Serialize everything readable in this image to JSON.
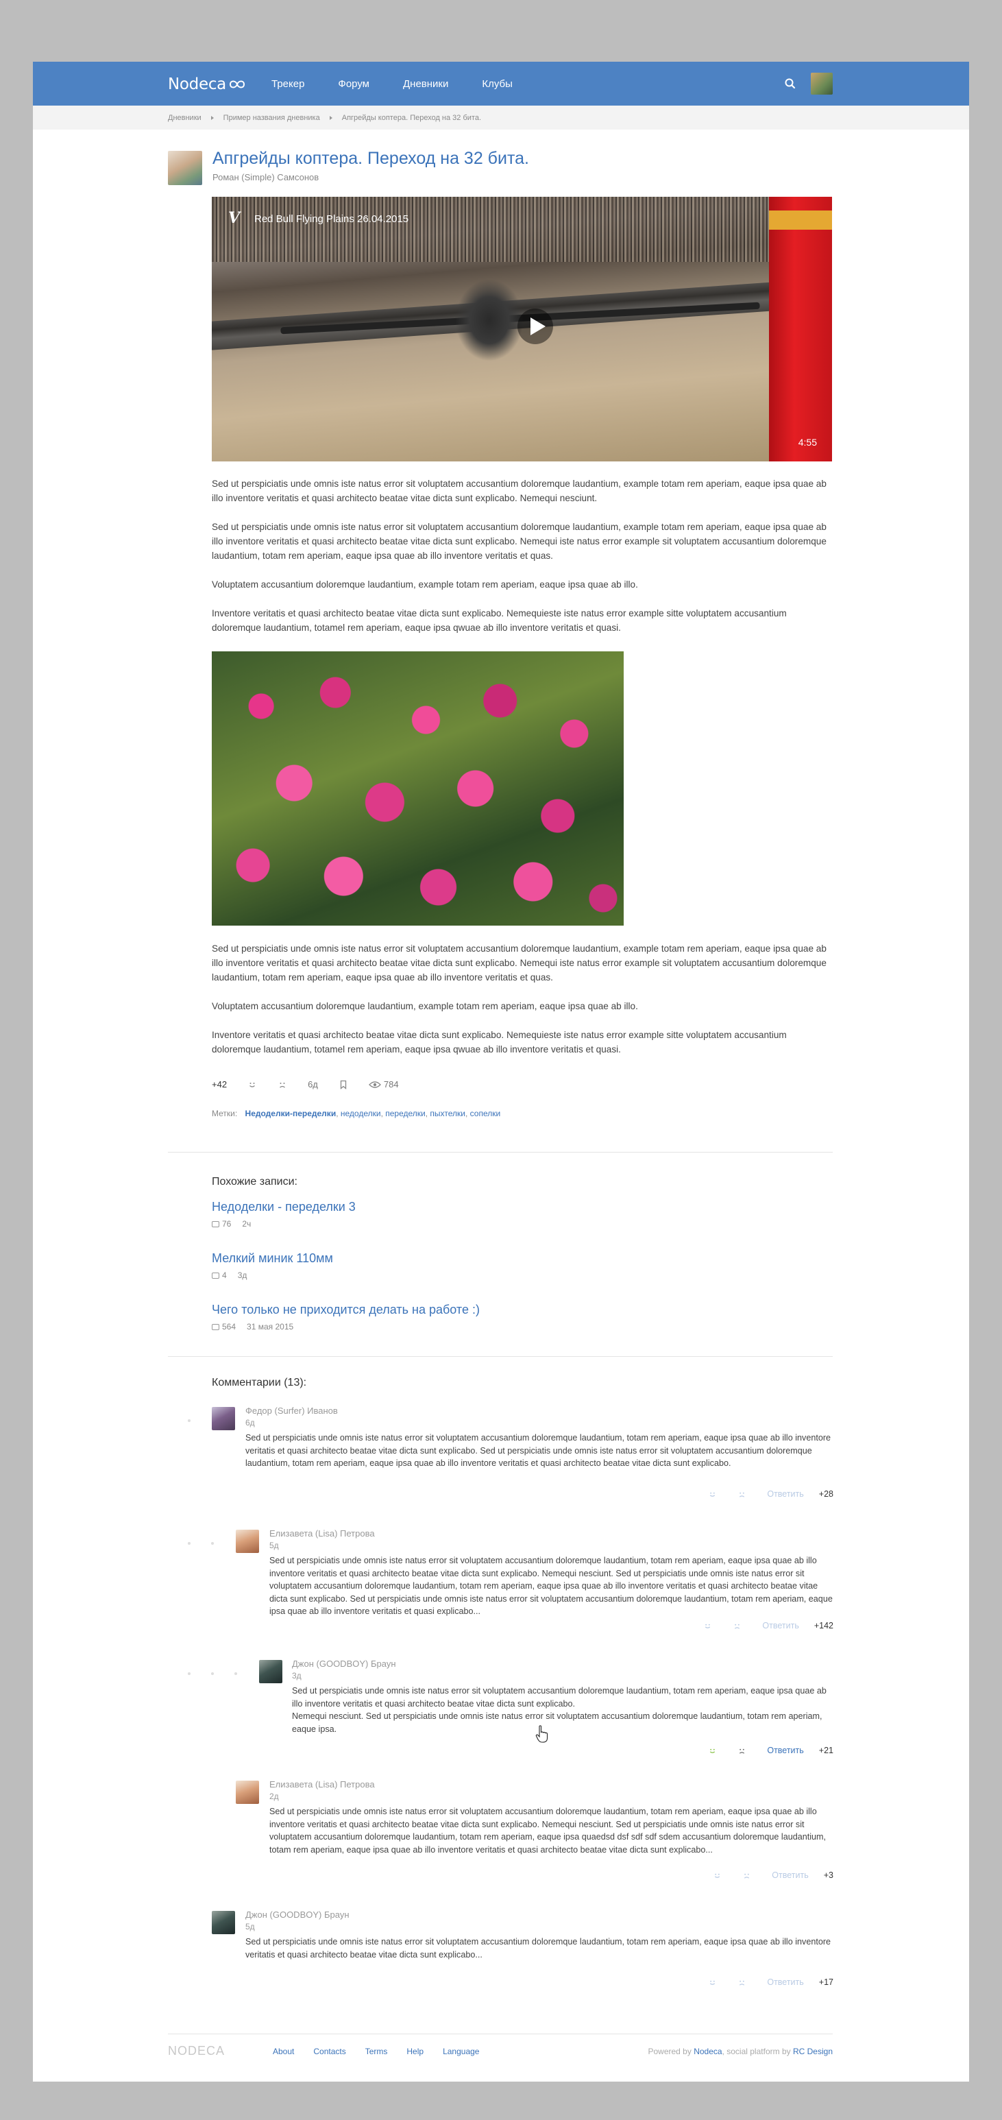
{
  "header": {
    "logo": "Nodeca",
    "nav": [
      "Трекер",
      "Форум",
      "Дневники",
      "Клубы"
    ]
  },
  "breadcrumbs": [
    "Дневники",
    "Пример названия дневника",
    "Апгрейды коптера. Переход на 32 бита."
  ],
  "post": {
    "title": "Апгрейды коптера. Переход на 32 бита.",
    "author": "Роман (Simple) Самсонов",
    "video": {
      "title": "Red Bull Flying Plains 26.04.2015",
      "duration": "4:55",
      "logo": "V"
    },
    "paragraphs_top": [
      "Sed ut perspiciatis unde omnis iste natus error sit voluptatem accusantium doloremque laudantium, example totam rem aperiam, eaque ipsa quae ab illo inventore veritatis et quasi architecto beatae vitae dicta sunt explicabo. Nemequi nesciunt.",
      "Sed ut perspiciatis unde omnis iste natus error sit voluptatem accusantium doloremque laudantium, example totam rem aperiam, eaque ipsa quae ab illo inventore veritatis et quasi architecto beatae vitae dicta sunt explicabo. Nemequi iste natus error example sit voluptatem accusantium doloremque laudantium,  totam rem aperiam, eaque ipsa quae ab illo inventore veritatis et quas.",
      "Voluptatem accusantium doloremque laudantium, example totam rem aperiam, eaque ipsa quae ab illo.",
      "Inventore veritatis et quasi architecto beatae vitae dicta sunt explicabo. Nemequieste iste natus error example sitte voluptatem accusantium doloremque laudantium,  totamel rem aperiam, eaque ipsa qwuae ab illo inventore veritatis et quasi."
    ],
    "paragraphs_bottom": [
      "Sed ut perspiciatis unde omnis iste natus error sit voluptatem accusantium doloremque laudantium, example totam rem aperiam, eaque ipsa quae ab illo inventore veritatis et quasi architecto beatae vitae dicta sunt explicabo. Nemequi iste natus error example sit voluptatem accusantium doloremque laudantium,  totam rem aperiam, eaque ipsa quae ab illo inventore veritatis et quas.",
      "Voluptatem accusantium doloremque laudantium, example totam rem aperiam, eaque ipsa quae ab illo.",
      "Inventore veritatis et quasi architecto beatae vitae dicta sunt explicabo. Nemequieste iste natus error example sitte voluptatem accusantium doloremque laudantium,  totamel rem aperiam, eaque ipsa qwuae ab illo inventore veritatis et quasi."
    ],
    "votes": "+42",
    "age": "6д",
    "views": "784",
    "tags_label": "Метки:",
    "tags": [
      "Недоделки-переделки",
      "недоделки",
      "переделки",
      "пыхтелки",
      "сопелки"
    ]
  },
  "similar": {
    "heading": "Похожие записи:",
    "items": [
      {
        "title": "Недоделки - переделки 3",
        "comments": "76",
        "age": "2ч"
      },
      {
        "title": "Мелкий миник 110мм",
        "comments": "4",
        "age": "3д"
      },
      {
        "title": "Чего только не приходится делать на работе :)",
        "comments": "564",
        "age": "31 мая 2015"
      }
    ]
  },
  "comments": {
    "heading": "Комментарии (13):",
    "reply_label": "Ответить",
    "items": [
      {
        "name": "Федор (Surfer) Иванов",
        "age": "6д",
        "text": "Sed ut perspiciatis unde omnis iste natus error sit voluptatem accusantium doloremque laudantium, totam rem aperiam, eaque ipsa quae ab illo inventore veritatis et quasi architecto beatae vitae dicta sunt explicabo. Sed ut perspiciatis unde omnis iste natus error sit voluptatem accusantium doloremque laudantium, totam rem aperiam, eaque ipsa quae ab illo inventore veritatis et quasi architecto beatae vitae dicta sunt explicabo.",
        "score": "+28"
      },
      {
        "name": "Елизавета (Lisa) Петрова",
        "age": "5д",
        "text": "Sed ut perspiciatis unde omnis iste natus error sit voluptatem accusantium doloremque laudantium, totam rem aperiam, eaque ipsa quae ab illo inventore veritatis et quasi architecto beatae vitae dicta sunt explicabo. Nemequi nesciunt. Sed ut perspiciatis unde omnis iste natus error sit voluptatem accusantium doloremque laudantium, totam rem aperiam, eaque ipsa quae ab illo inventore veritatis et quasi architecto beatae vitae dicta sunt explicabo. Sed ut perspiciatis unde omnis iste natus error sit voluptatem accusantium doloremque laudantium, totam rem aperiam, eaque ipsa quae ab illo inventore veritatis et quasi explicabo...",
        "score": "+142"
      },
      {
        "name": "Джон (GOODBOY) Браун",
        "age": "3д",
        "text": "Sed ut perspiciatis unde omnis iste natus error sit voluptatem accusantium doloremque laudantium, totam rem aperiam, eaque ipsa quae ab illo inventore veritatis et quasi architecto beatae vitae dicta sunt explicabo.",
        "text2": "Nemequi nesciunt. Sed ut perspiciatis unde omnis iste natus error sit voluptatem accusantium doloremque laudantium, totam rem aperiam, eaque ipsa.",
        "score": "+21"
      },
      {
        "name": "Елизавета (Lisa) Петрова",
        "age": "2д",
        "text": "Sed ut perspiciatis unde omnis iste natus error sit voluptatem accusantium doloremque laudantium, totam rem aperiam, eaque ipsa quae ab illo inventore veritatis et quasi architecto beatae vitae dicta sunt explicabo. Nemequi nesciunt. Sed ut perspiciatis unde omnis iste natus error sit voluptatem accusantium doloremque laudantium, totam rem aperiam, eaque ipsa quaedsd dsf sdf sdf sdem accusantium doloremque laudantium, totam rem aperiam, eaque ipsa quae ab illo inventore veritatis et quasi architecto beatae vitae dicta sunt explicabo...",
        "score": "+3"
      },
      {
        "name": "Джон (GOODBOY) Браун",
        "age": "5д",
        "text": "Sed ut perspiciatis unde omnis iste natus error sit voluptatem accusantium doloremque laudantium, totam rem aperiam, eaque ipsa quae ab illo inventore veritatis et quasi architecto beatae vitae dicta sunt explicabo...",
        "score": "+17"
      }
    ]
  },
  "footer": {
    "brand": "NODECA",
    "links": [
      "About",
      "Contacts",
      "Terms",
      "Help",
      "Language"
    ],
    "powered_prefix": "Powered by",
    "powered_link1": "Nodeca",
    "powered_mid": ", social platform by",
    "powered_link2": "RC Design"
  },
  "colors": {
    "brand_blue": "#4d82c3",
    "link": "#3b73b9",
    "reply_inactive": "#b9cbe4",
    "upvote_active": "#8bc34a"
  }
}
